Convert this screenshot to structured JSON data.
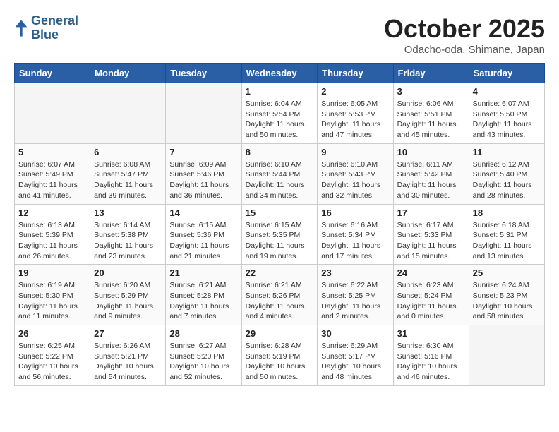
{
  "header": {
    "logo": {
      "line1": "General",
      "line2": "Blue"
    },
    "title": "October 2025",
    "location": "Odacho-oda, Shimane, Japan"
  },
  "weekdays": [
    "Sunday",
    "Monday",
    "Tuesday",
    "Wednesday",
    "Thursday",
    "Friday",
    "Saturday"
  ],
  "weeks": [
    [
      {
        "day": "",
        "info": ""
      },
      {
        "day": "",
        "info": ""
      },
      {
        "day": "",
        "info": ""
      },
      {
        "day": "1",
        "info": "Sunrise: 6:04 AM\nSunset: 5:54 PM\nDaylight: 11 hours\nand 50 minutes."
      },
      {
        "day": "2",
        "info": "Sunrise: 6:05 AM\nSunset: 5:53 PM\nDaylight: 11 hours\nand 47 minutes."
      },
      {
        "day": "3",
        "info": "Sunrise: 6:06 AM\nSunset: 5:51 PM\nDaylight: 11 hours\nand 45 minutes."
      },
      {
        "day": "4",
        "info": "Sunrise: 6:07 AM\nSunset: 5:50 PM\nDaylight: 11 hours\nand 43 minutes."
      }
    ],
    [
      {
        "day": "5",
        "info": "Sunrise: 6:07 AM\nSunset: 5:49 PM\nDaylight: 11 hours\nand 41 minutes."
      },
      {
        "day": "6",
        "info": "Sunrise: 6:08 AM\nSunset: 5:47 PM\nDaylight: 11 hours\nand 39 minutes."
      },
      {
        "day": "7",
        "info": "Sunrise: 6:09 AM\nSunset: 5:46 PM\nDaylight: 11 hours\nand 36 minutes."
      },
      {
        "day": "8",
        "info": "Sunrise: 6:10 AM\nSunset: 5:44 PM\nDaylight: 11 hours\nand 34 minutes."
      },
      {
        "day": "9",
        "info": "Sunrise: 6:10 AM\nSunset: 5:43 PM\nDaylight: 11 hours\nand 32 minutes."
      },
      {
        "day": "10",
        "info": "Sunrise: 6:11 AM\nSunset: 5:42 PM\nDaylight: 11 hours\nand 30 minutes."
      },
      {
        "day": "11",
        "info": "Sunrise: 6:12 AM\nSunset: 5:40 PM\nDaylight: 11 hours\nand 28 minutes."
      }
    ],
    [
      {
        "day": "12",
        "info": "Sunrise: 6:13 AM\nSunset: 5:39 PM\nDaylight: 11 hours\nand 26 minutes."
      },
      {
        "day": "13",
        "info": "Sunrise: 6:14 AM\nSunset: 5:38 PM\nDaylight: 11 hours\nand 23 minutes."
      },
      {
        "day": "14",
        "info": "Sunrise: 6:15 AM\nSunset: 5:36 PM\nDaylight: 11 hours\nand 21 minutes."
      },
      {
        "day": "15",
        "info": "Sunrise: 6:15 AM\nSunset: 5:35 PM\nDaylight: 11 hours\nand 19 minutes."
      },
      {
        "day": "16",
        "info": "Sunrise: 6:16 AM\nSunset: 5:34 PM\nDaylight: 11 hours\nand 17 minutes."
      },
      {
        "day": "17",
        "info": "Sunrise: 6:17 AM\nSunset: 5:33 PM\nDaylight: 11 hours\nand 15 minutes."
      },
      {
        "day": "18",
        "info": "Sunrise: 6:18 AM\nSunset: 5:31 PM\nDaylight: 11 hours\nand 13 minutes."
      }
    ],
    [
      {
        "day": "19",
        "info": "Sunrise: 6:19 AM\nSunset: 5:30 PM\nDaylight: 11 hours\nand 11 minutes."
      },
      {
        "day": "20",
        "info": "Sunrise: 6:20 AM\nSunset: 5:29 PM\nDaylight: 11 hours\nand 9 minutes."
      },
      {
        "day": "21",
        "info": "Sunrise: 6:21 AM\nSunset: 5:28 PM\nDaylight: 11 hours\nand 7 minutes."
      },
      {
        "day": "22",
        "info": "Sunrise: 6:21 AM\nSunset: 5:26 PM\nDaylight: 11 hours\nand 4 minutes."
      },
      {
        "day": "23",
        "info": "Sunrise: 6:22 AM\nSunset: 5:25 PM\nDaylight: 11 hours\nand 2 minutes."
      },
      {
        "day": "24",
        "info": "Sunrise: 6:23 AM\nSunset: 5:24 PM\nDaylight: 11 hours\nand 0 minutes."
      },
      {
        "day": "25",
        "info": "Sunrise: 6:24 AM\nSunset: 5:23 PM\nDaylight: 10 hours\nand 58 minutes."
      }
    ],
    [
      {
        "day": "26",
        "info": "Sunrise: 6:25 AM\nSunset: 5:22 PM\nDaylight: 10 hours\nand 56 minutes."
      },
      {
        "day": "27",
        "info": "Sunrise: 6:26 AM\nSunset: 5:21 PM\nDaylight: 10 hours\nand 54 minutes."
      },
      {
        "day": "28",
        "info": "Sunrise: 6:27 AM\nSunset: 5:20 PM\nDaylight: 10 hours\nand 52 minutes."
      },
      {
        "day": "29",
        "info": "Sunrise: 6:28 AM\nSunset: 5:19 PM\nDaylight: 10 hours\nand 50 minutes."
      },
      {
        "day": "30",
        "info": "Sunrise: 6:29 AM\nSunset: 5:17 PM\nDaylight: 10 hours\nand 48 minutes."
      },
      {
        "day": "31",
        "info": "Sunrise: 6:30 AM\nSunset: 5:16 PM\nDaylight: 10 hours\nand 46 minutes."
      },
      {
        "day": "",
        "info": ""
      }
    ]
  ]
}
